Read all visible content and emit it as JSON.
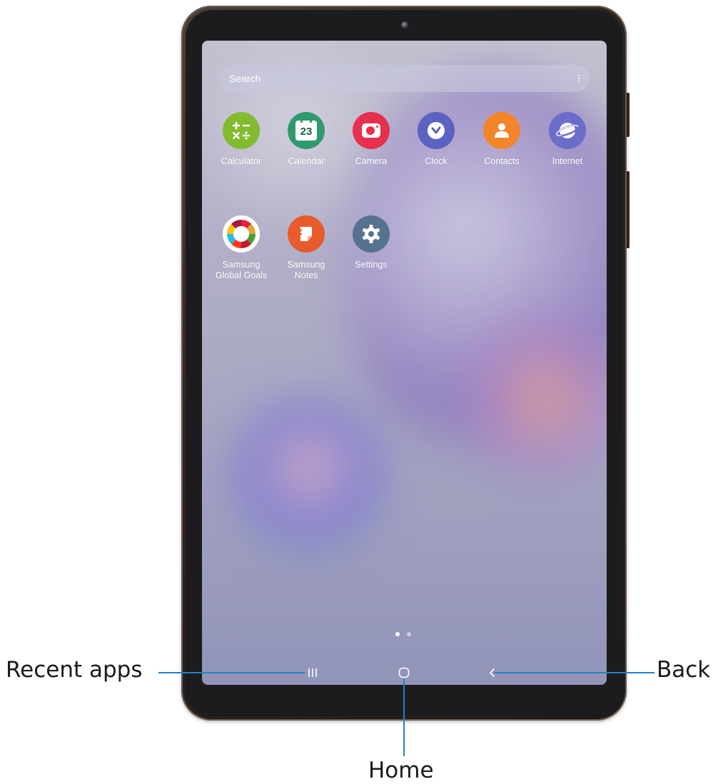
{
  "search": {
    "placeholder": "Search"
  },
  "apps": [
    {
      "label": "Calculator",
      "icon": "calculator-icon",
      "color": "#82bb2f"
    },
    {
      "label": "Calendar",
      "icon": "calendar-icon",
      "color": "#2f9a6e",
      "badge": "23"
    },
    {
      "label": "Camera",
      "icon": "camera-icon",
      "color": "#e7304d"
    },
    {
      "label": "Clock",
      "icon": "clock-icon",
      "color": "#5b62c1"
    },
    {
      "label": "Contacts",
      "icon": "contacts-icon",
      "color": "#f2852a"
    },
    {
      "label": "Internet",
      "icon": "internet-icon",
      "color": "#6b6ec9"
    },
    {
      "label": "Samsung\nGlobal Goals",
      "icon": "global-goals-icon",
      "color": "#ffffff"
    },
    {
      "label": "Samsung\nNotes",
      "icon": "notes-icon",
      "color": "#e85b2c"
    },
    {
      "label": "Settings",
      "icon": "settings-icon",
      "color": "#55738e"
    }
  ],
  "page_indicator": {
    "count": 2,
    "active": 1
  },
  "nav_bar": {
    "recent": "recent-apps-icon",
    "home": "home-icon",
    "back": "back-icon"
  },
  "callouts": {
    "recent": "Recent apps",
    "home": "Home",
    "back": "Back"
  },
  "accent_color": "#1e82c6"
}
